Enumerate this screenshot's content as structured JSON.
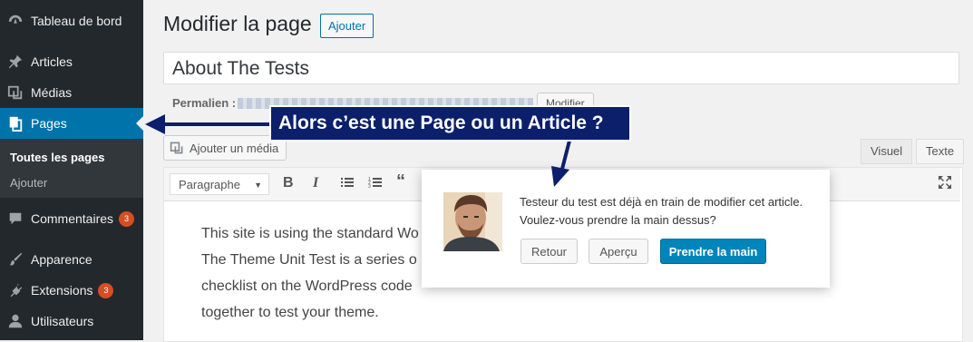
{
  "sidebar": {
    "items": [
      {
        "label": "Tableau de bord",
        "icon": "dashboard-icon"
      },
      {
        "label": "Articles",
        "icon": "pin-icon"
      },
      {
        "label": "Médias",
        "icon": "media-icon"
      },
      {
        "label": "Pages",
        "icon": "pages-icon",
        "active": true
      },
      {
        "label": "Commentaires",
        "icon": "comment-icon",
        "badge": "3"
      },
      {
        "label": "Apparence",
        "icon": "brush-icon"
      },
      {
        "label": "Extensions",
        "icon": "plugin-icon",
        "badge": "3"
      },
      {
        "label": "Utilisateurs",
        "icon": "users-icon"
      }
    ],
    "submenu": [
      {
        "label": "Toutes les pages",
        "current": true
      },
      {
        "label": "Ajouter"
      }
    ]
  },
  "header": {
    "title": "Modifier la page",
    "add_new": "Ajouter"
  },
  "post": {
    "title": "About The Tests",
    "permalink_label": "Permalien :",
    "modify_button": "Modifier"
  },
  "editor": {
    "add_media": "Ajouter un média",
    "tabs": {
      "visual": "Visuel",
      "text": "Texte"
    },
    "format": "Paragraphe",
    "lines": [
      "This site is using the standard Wo",
      "The Theme Unit Test is a series o",
      "checklist on the WordPress code",
      "together to test your theme."
    ]
  },
  "dialog": {
    "message": "Testeur du test est déjà en train de modifier cet article. Voulez-vous prendre la main dessus?",
    "back": "Retour",
    "preview": "Aperçu",
    "take_over": "Prendre la main"
  },
  "annotation": {
    "text": "Alors c’est une Page ou un Article ?"
  },
  "colors": {
    "sidebar_bg": "#23282d",
    "accent": "#0073aa",
    "annotation_bg": "#0b1f6b",
    "badge": "#d54e21"
  }
}
